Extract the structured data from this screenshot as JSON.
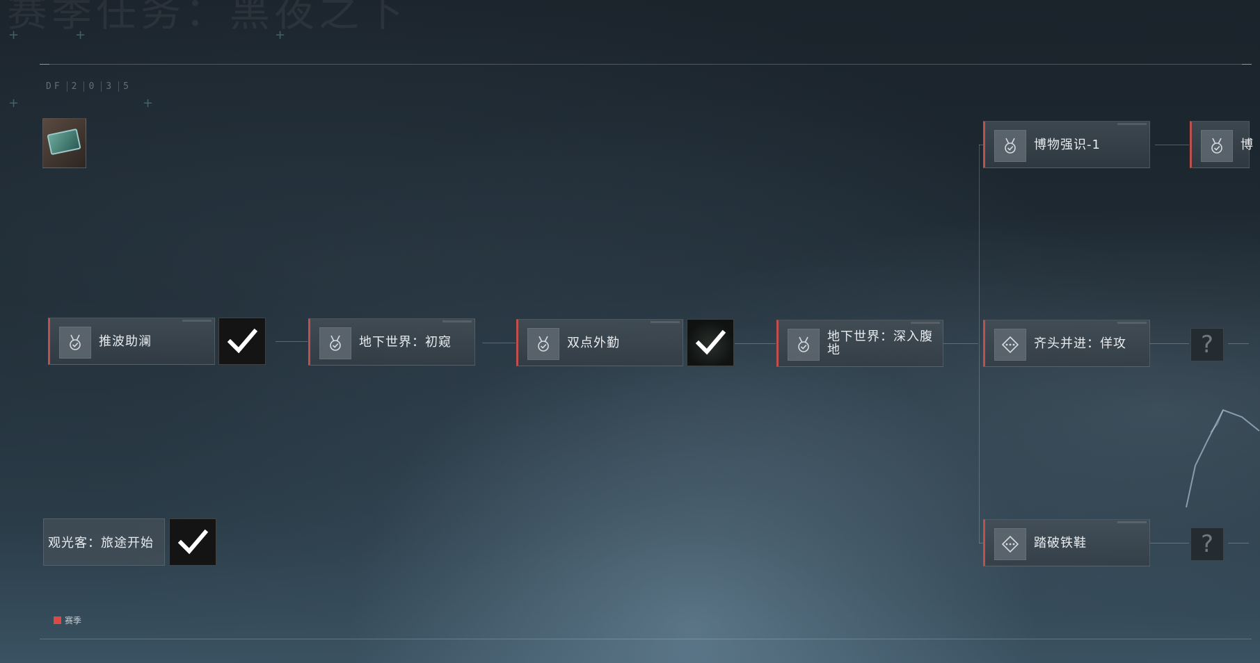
{
  "header": {
    "background_title": "赛季任务：黑夜之下"
  },
  "hud": {
    "code_label": "DF",
    "code_digits": [
      "2",
      "0",
      "3",
      "5"
    ]
  },
  "legend": {
    "label": "赛季",
    "color": "#d94a45"
  },
  "quests": {
    "row1": [
      {
        "label": "推波助澜",
        "icon": "medal-check-icon",
        "reward": "completed-check"
      },
      {
        "label": "地下世界：初窥",
        "icon": "medal-check-icon"
      },
      {
        "label": "双点外勤",
        "icon": "medal-check-icon",
        "reward": "completed-check"
      },
      {
        "label": "地下世界：深入腹地",
        "icon": "medal-check-icon"
      },
      {
        "label": "齐头并进：佯攻",
        "icon": "diamond-dots-icon",
        "reward": "unknown"
      }
    ],
    "top_branch": [
      {
        "label": "博物强识-1",
        "icon": "medal-check-icon"
      },
      {
        "label": "博",
        "icon": "medal-check-icon"
      }
    ],
    "bottom_branch": [
      {
        "label": "踏破铁鞋",
        "icon": "diamond-dots-icon",
        "reward": "unknown"
      }
    ],
    "start": {
      "label": "观光客：旅途开始",
      "reward": "completed-check"
    }
  },
  "unknown_symbol": "?",
  "colors": {
    "accent_red": "#c0504d",
    "card_bg": "#454f57",
    "check_white": "#ffffff"
  }
}
